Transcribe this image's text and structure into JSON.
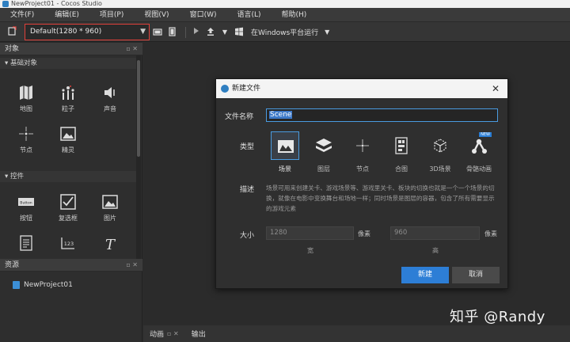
{
  "window": {
    "title": "NewProject01 - Cocos Studio"
  },
  "menu": [
    "文件(F)",
    "编辑(E)",
    "项目(P)",
    "视图(V)",
    "窗口(W)",
    "语言(L)",
    "帮助(H)"
  ],
  "toolbar": {
    "resolution": "Default(1280 * 960)",
    "run_label": "在Windows平台运行"
  },
  "object_panel": {
    "title": "对象",
    "basic_section": "基础对象",
    "basic_items": [
      "地图",
      "粒子",
      "声音",
      "节点",
      "精灵"
    ],
    "control_section": "控件",
    "control_items": [
      "按钮",
      "复选框",
      "图片"
    ],
    "button_icon_text": "Button",
    "textbox_icon_text": "123"
  },
  "assets_panel": {
    "title": "资源",
    "project": "NewProject01"
  },
  "bottom_tabs": [
    "动画",
    "输出"
  ],
  "watermark": "知乎 @Randy",
  "dialog": {
    "title": "新建文件",
    "name_label": "文件名称",
    "name_value": "Scene",
    "type_label": "类型",
    "types": [
      "场景",
      "图层",
      "节点",
      "合图",
      "3D场景",
      "骨骼动画"
    ],
    "selected_type": "场景",
    "new_badge": "NEW",
    "desc_label": "描述",
    "description": "场景可用来创建关卡、游戏场景等、游戏里关卡、板块的切换也就是一个一个场景的切换，就像在电影中变换舞台和场地一样；同时场景是图层的容器，包含了所有需要显示的游戏元素",
    "size_label": "大小",
    "width_value": "1280",
    "height_value": "960",
    "unit": "像素",
    "width_label": "宽",
    "height_label": "高",
    "create_button": "新建",
    "cancel_button": "取消"
  },
  "colors": {
    "accent": "#2d7ed6",
    "highlight_border": "#e0403a",
    "background": "#2b2b2b"
  }
}
